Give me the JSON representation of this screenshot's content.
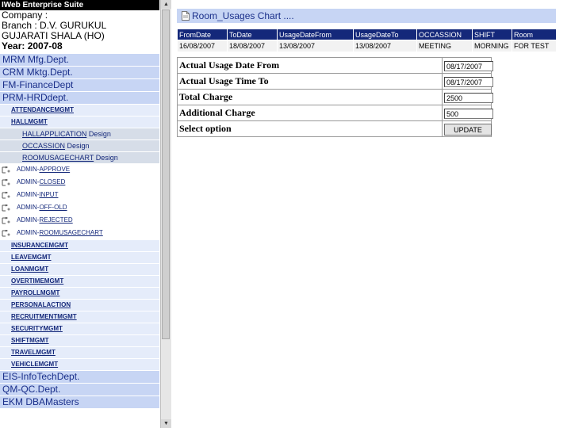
{
  "left": {
    "app_title": "IWeb Enterprise Suite",
    "info_lines": [
      "Company :",
      "Branch : D.V. GURUKUL",
      "GUJARATI SHALA (HO)"
    ],
    "year": "Year: 2007-08",
    "depts_top": [
      "MRM Mfg.Dept.",
      "CRM Mktg.Dept.",
      "FM-FinanceDept",
      "PRM-HRDdept."
    ],
    "subs_a": [
      "ATTENDANCEMGMT",
      "HALLMGMT"
    ],
    "subsub": [
      {
        "label": "HALLAPPLICATION",
        "suffix": " Design"
      },
      {
        "label": "OCCASSION",
        "suffix": " Design"
      },
      {
        "label": "ROOMUSAGECHART",
        "suffix": " Design"
      }
    ],
    "admin_items": [
      {
        "prefix": "ADMIN-",
        "label": "APPROVE"
      },
      {
        "prefix": "ADMIN-",
        "label": "CLOSED"
      },
      {
        "prefix": "ADMIN-",
        "label": "INPUT"
      },
      {
        "prefix": "ADMIN-",
        "label": "OFF-OLD"
      },
      {
        "prefix": "ADMIN-",
        "label": "REJECTED"
      },
      {
        "prefix": "ADMIN-",
        "label": "ROOMUSAGECHART"
      }
    ],
    "subs_b": [
      "INSURANCEMGMT",
      "LEAVEMGMT",
      "LOANMGMT",
      "OVERTIMEMGMT",
      "PAYROLLMGMT",
      "PERSONALACTION",
      "RECRUITMENTMGMT",
      "SECURITYMGMT",
      "SHIFTMGMT",
      "TRAVELMGMT",
      "VEHICLEMGMT"
    ],
    "depts_bottom": [
      "EIS-InfoTechDept.",
      "QM-QC.Dept.",
      "EKM DBAMasters"
    ]
  },
  "main": {
    "chart_title": "Room_Usages Chart ....",
    "table": {
      "headers": [
        "FromDate",
        "ToDate",
        "UsageDateFrom",
        "UsageDateTo",
        "OCCASSION",
        "SHIFT",
        "Room"
      ],
      "row": [
        "16/08/2007",
        "18/08/2007",
        "13/08/2007",
        "13/08/2007",
        "MEETING",
        "MORNING",
        "FOR TEST"
      ]
    },
    "form": {
      "rows": [
        {
          "label": "Actual Usage Date From",
          "value": "08/17/2007"
        },
        {
          "label": "Actual Usage Time To",
          "value": "08/17/2007"
        },
        {
          "label": "Total Charge",
          "value": "2500"
        },
        {
          "label": "Additional Charge",
          "value": "500"
        }
      ],
      "select_label": "Select option",
      "update_label": "UPDATE"
    }
  },
  "colors": {
    "nav_bg": "#c7d5f4",
    "nav_text": "#1a2f8a",
    "header_bg": "#14287a",
    "title_bar_bg": "#000000"
  }
}
